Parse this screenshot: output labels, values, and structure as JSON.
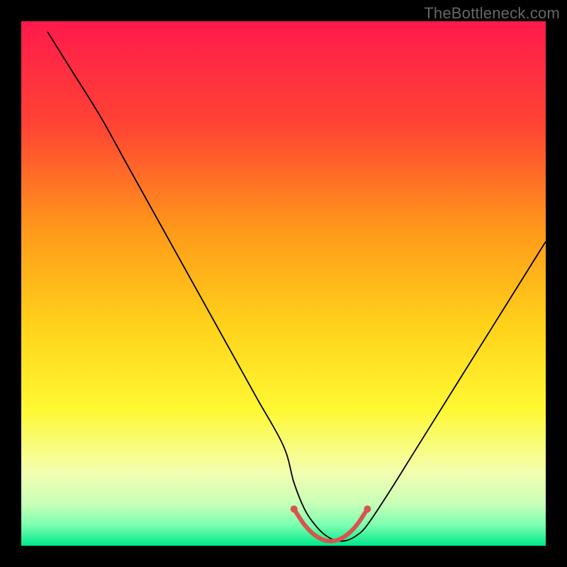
{
  "watermark": "TheBottleneck.com",
  "chart_data": {
    "type": "line",
    "title": "",
    "xlabel": "",
    "ylabel": "",
    "xlim": [
      0,
      100
    ],
    "ylim": [
      0,
      100
    ],
    "x": [
      5,
      10,
      15,
      20,
      25,
      30,
      35,
      40,
      45,
      50,
      52,
      54,
      56,
      58,
      60,
      62,
      64,
      66,
      70,
      75,
      80,
      85,
      90,
      95,
      100
    ],
    "values": [
      98,
      90,
      82,
      73,
      64,
      55,
      46,
      37,
      28,
      19,
      12,
      7,
      4,
      2,
      1,
      1,
      2,
      4,
      10,
      18,
      26,
      34,
      42,
      50,
      58
    ],
    "highlight_segment": {
      "x": [
        52,
        54,
        56,
        58,
        60,
        62,
        64,
        66
      ],
      "y": [
        7,
        4,
        2,
        1,
        1,
        2,
        4,
        7
      ],
      "color": "#d9534f"
    },
    "gradient_stops": [
      {
        "offset": 0.0,
        "color": "#ff1a4d"
      },
      {
        "offset": 0.2,
        "color": "#ff4433"
      },
      {
        "offset": 0.4,
        "color": "#ff9a1a"
      },
      {
        "offset": 0.58,
        "color": "#ffd21a"
      },
      {
        "offset": 0.74,
        "color": "#fff833"
      },
      {
        "offset": 0.86,
        "color": "#f3ffb0"
      },
      {
        "offset": 0.92,
        "color": "#c8ffb8"
      },
      {
        "offset": 0.96,
        "color": "#7dffb0"
      },
      {
        "offset": 1.0,
        "color": "#00e88a"
      }
    ]
  }
}
